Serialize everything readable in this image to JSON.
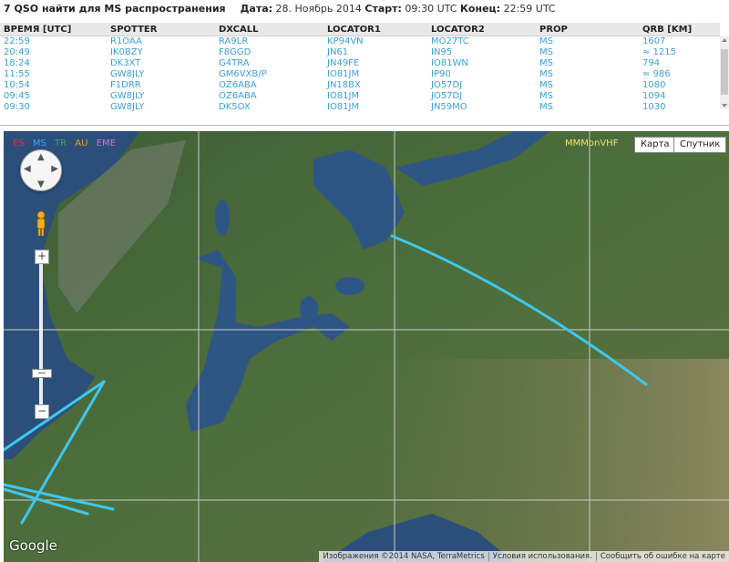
{
  "summary": {
    "title": "7 QSO найти для MS распространения",
    "date_label": "Дата:",
    "date_value": "28. Ноябрь 2014",
    "start_label": "Старт:",
    "start_value": "09:30 UTC",
    "end_label": "Конец:",
    "end_value": "22:59 UTC"
  },
  "table": {
    "headers": [
      "ВРЕМЯ [UTC]",
      "SPOTTER",
      "DXCALL",
      "LOCATOR1",
      "LOCATOR2",
      "PROP",
      "QRB [KM]"
    ],
    "rows": [
      [
        "22:59",
        "R1OAA",
        "RA9LR",
        "KP94VN",
        "MO27TC",
        "MS",
        "1607"
      ],
      [
        "20:49",
        "IK0BZY",
        "F8GGD",
        "JN61",
        "IN95",
        "MS",
        "≈ 1215"
      ],
      [
        "18:24",
        "DK3XT",
        "G4TRA",
        "JN49FE",
        "IO81WN",
        "MS",
        "794"
      ],
      [
        "11:55",
        "GW8JLY",
        "GM6VXB/P",
        "IO81JM",
        "IP90",
        "MS",
        "≈ 986"
      ],
      [
        "10:54",
        "F1DRR",
        "OZ6ABA",
        "JN18BX",
        "JO57DJ",
        "MS",
        "1080"
      ],
      [
        "09:45",
        "GW8JLY",
        "OZ6ABA",
        "IO81JM",
        "JO57DJ",
        "MS",
        "1094"
      ],
      [
        "09:30",
        "GW8JLY",
        "DK5OX",
        "IO81JM",
        "JN59MO",
        "MS",
        "1030"
      ]
    ],
    "link_color": "#3aa0d6"
  },
  "map": {
    "legend": [
      {
        "label": "ES",
        "color": "#e03030"
      },
      {
        "label": "MS",
        "color": "#3aa0ff"
      },
      {
        "label": "TR",
        "color": "#30b050"
      },
      {
        "label": "AU",
        "color": "#e0a020"
      },
      {
        "label": "EME",
        "color": "#d070d0"
      }
    ],
    "brand": "MMMonVHF",
    "map_button": "Карта",
    "satellite_button": "Спутник",
    "zoom_in": "+",
    "zoom_out": "−",
    "google_logo": "Google",
    "attribution": "Изображения ©2014 NASA, TerraMetrics",
    "terms": "Условия использования.",
    "report": "Сообщить об ошибке на карте",
    "path_color": "#3ec8f0"
  }
}
